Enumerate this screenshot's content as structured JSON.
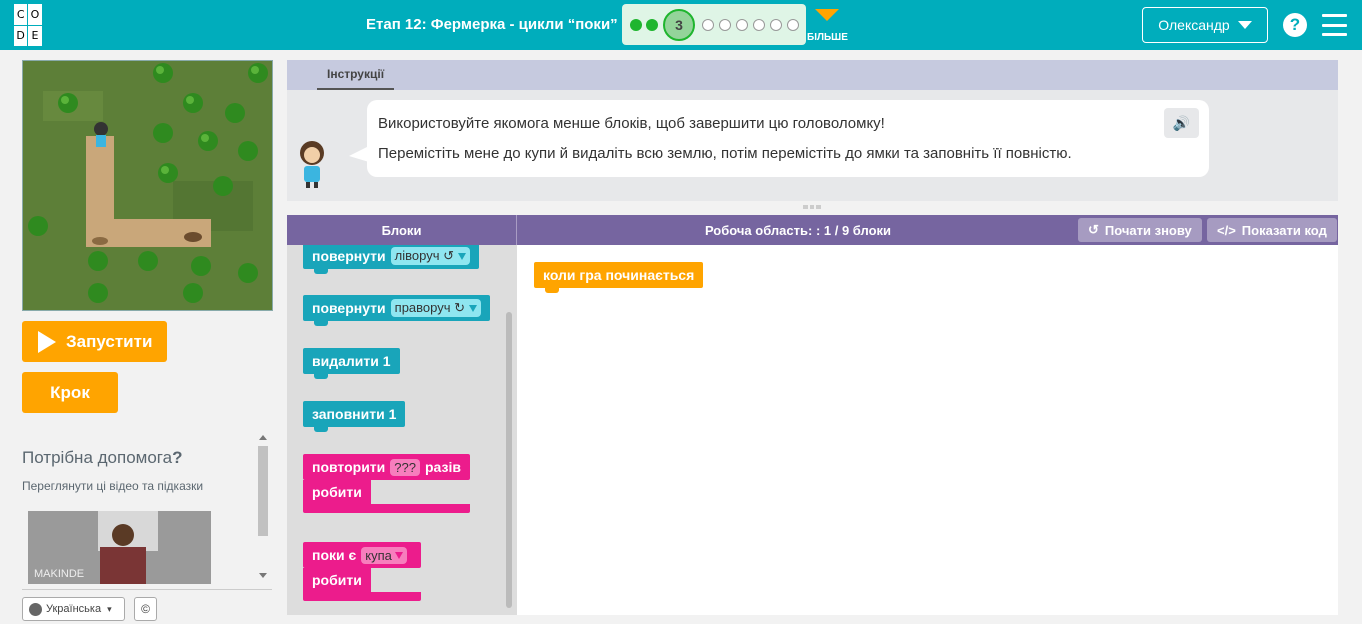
{
  "header": {
    "logo_letters": [
      "C",
      "O",
      "D",
      "E"
    ],
    "stage_title": "Етап 12: Фермерка - цикли “поки”",
    "current_level": "3",
    "more_label": "БІЛЬШЕ",
    "user_name": "Олександр",
    "help_symbol": "?"
  },
  "controls": {
    "run_label": "Запустити",
    "step_label": "Крок"
  },
  "help": {
    "title": "Потрібна допомога",
    "title_mark": "?",
    "subtitle": "Переглянути ці відео та підказки",
    "video_caption": "MAKINDE"
  },
  "footer": {
    "language": "Українська",
    "copyright_symbol": "©"
  },
  "instructions": {
    "tab_label": "Інструкції",
    "line1": "Використовуйте якомога менше блоків, щоб завершити цю головоломку!",
    "line2": "Перемістіть мене до купи й видаліть всю землю, потім перемістіть до ямки та заповніть її повністю."
  },
  "workspace": {
    "blocks_header": "Блоки",
    "area_label": "Робоча область: : 1 / 9 блоки",
    "restart_label": "Почати знову",
    "show_code_label": "Показати код",
    "start_block": "коли гра починається"
  },
  "toolbox": {
    "turn_left": {
      "label": "повернути",
      "option": "ліворуч ↺"
    },
    "turn_right": {
      "label": "повернути",
      "option": "праворуч ↻"
    },
    "remove": "видалити 1",
    "fill": "заповнити 1",
    "repeat": {
      "label": "повторити",
      "value": "???",
      "suffix": "разів",
      "do": "робити"
    },
    "while": {
      "label": "поки є",
      "option": "купа",
      "do": "робити"
    }
  }
}
